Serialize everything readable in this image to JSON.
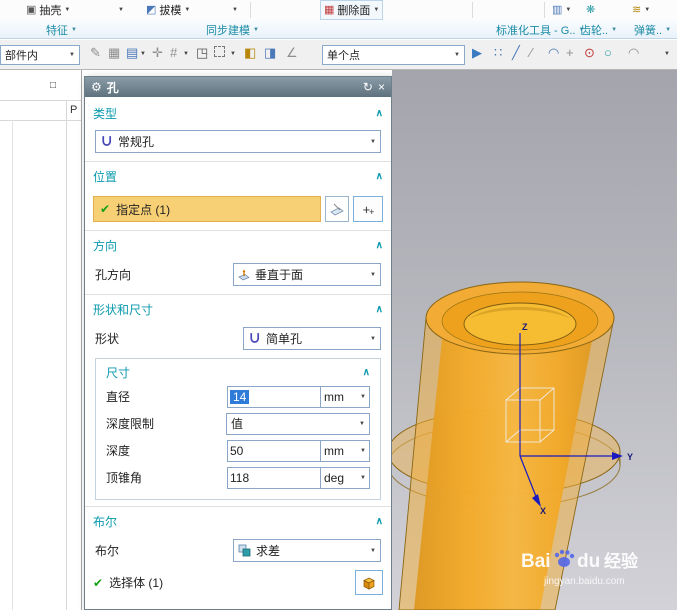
{
  "icons": {
    "gear": "⚙",
    "reset": "↻",
    "close": "×",
    "check": "✔",
    "caret": "▼",
    "chev": "∧",
    "shell": "▣",
    "draft": "◩",
    "delete_face": "▦",
    "doc": "▥",
    "gear2": "❋",
    "spring": "≋",
    "sketch": "✎",
    "grid": "▦",
    "pattern": "▤",
    "axis": "✛",
    "hash": "#",
    "cube": "◳",
    "boxa": "◧",
    "boxb": "◨",
    "arrow": "▶",
    "snap_points": "∷",
    "snap_end": "╱",
    "snap_mid": "∕",
    "snap_arc": "◠",
    "snap_plus": "+",
    "snap_center": "⊙",
    "snap_circle": "○",
    "angle": "∠",
    "window": "□",
    "plus_big": "+",
    "plus_small": "+"
  },
  "ribbon": {
    "shell": "抽壳",
    "draft": "拔模",
    "delete_face": "删除面"
  },
  "tabs": {
    "feature": "特征",
    "sync": "同步建模",
    "std": "标准化工具 - G..",
    "gear": "齿轮..",
    "spring": "弹簧.."
  },
  "toolbar": {
    "scope": "部件内",
    "point": "单个点"
  },
  "navigator": {
    "col": "P"
  },
  "dialog": {
    "title": "孔",
    "type_header": "类型",
    "type_value": "常规孔",
    "pos_header": "位置",
    "pos_point": "指定点 (1)",
    "dir_header": "方向",
    "dir_label": "孔方向",
    "dir_value": "垂直于面",
    "shape_header": "形状和尺寸",
    "shape_label": "形状",
    "shape_value": "简单孔",
    "dims_header": "尺寸",
    "dim_dia_label": "直径",
    "dim_dia_value": "14",
    "dim_dia_unit": "mm",
    "dim_limit_label": "深度限制",
    "dim_limit_value": "值",
    "dim_depth_label": "深度",
    "dim_depth_value": "50",
    "dim_depth_unit": "mm",
    "dim_angle_label": "顶锥角",
    "dim_angle_value": "118",
    "dim_angle_unit": "deg",
    "bool_header": "布尔",
    "bool_label": "布尔",
    "bool_value": "求差",
    "body_select": "选择体 (1)"
  },
  "viewport": {
    "z": "Z",
    "y": "Y",
    "x": "X",
    "wm1": "Bai",
    "wm2": "du",
    "wm3": "经验",
    "wm_url": "jingyan.baidu.com"
  },
  "colors": {
    "accent_teal": "#0b9aae",
    "highlight_yellow": "#f7cf74",
    "selection_blue": "#2f7bd9",
    "model_orange": "#f0a020"
  }
}
